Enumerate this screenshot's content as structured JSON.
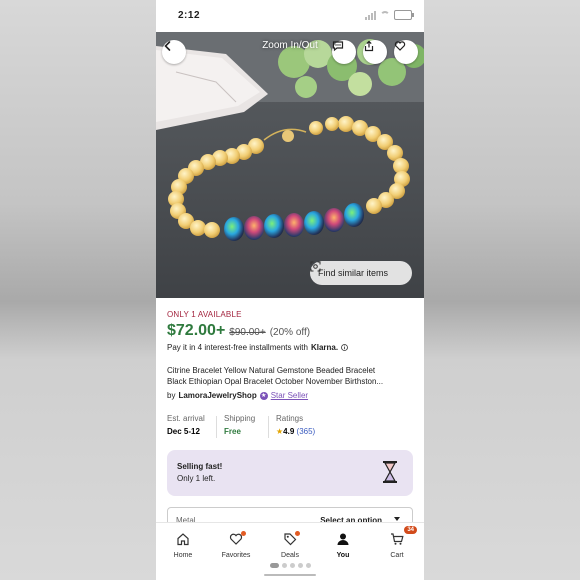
{
  "status_bar": {
    "time": "2:12"
  },
  "photo": {
    "zoom_label": "Zoom In/Out",
    "find_similar_label": "Find similar items"
  },
  "listing": {
    "availability": "ONLY 1 AVAILABLE",
    "price": "$72.00+",
    "original_price": "$90.00+",
    "discount": "(20% off)",
    "installments_text": "Pay it in 4 interest-free installments with",
    "klarna_label": "Klarna.",
    "title_line1": "Citrine Bracelet Yellow Natural Gemstone Beaded Bracelet",
    "title_line2": "Black Ethiopian Opal Bracelet October November Birthston...",
    "by_label": "by",
    "shop_name": "LamoraJewelryShop",
    "star_seller_label": "Star Seller"
  },
  "info": {
    "arrival_label": "Est. arrival",
    "arrival_value": "Dec 5-12",
    "shipping_label": "Shipping",
    "shipping_value": "Free",
    "ratings_label": "Ratings",
    "rating_value": "4.9",
    "rating_count": "(365)"
  },
  "selling_fast": {
    "title": "Selling fast!",
    "subtitle": "Only 1 left."
  },
  "metal_select": {
    "label": "Metal",
    "value": "Select an option"
  },
  "tabbar": {
    "home": "Home",
    "favorites": "Favorites",
    "deals": "Deals",
    "you": "You",
    "cart": "Cart",
    "cart_count": "34"
  },
  "colors": {
    "price_green": "#2f7a3e",
    "availability_red": "#a3253f",
    "star_seller_purple": "#7b52b8",
    "selling_fast_bg": "#e9e3f2",
    "badge_orange": "#d24b1b"
  },
  "icons": [
    "back-icon",
    "message-icon",
    "share-icon",
    "heart-icon",
    "scan-icon",
    "hourglass-icon",
    "home-icon",
    "favorites-icon",
    "deals-icon",
    "you-icon",
    "cart-icon"
  ]
}
